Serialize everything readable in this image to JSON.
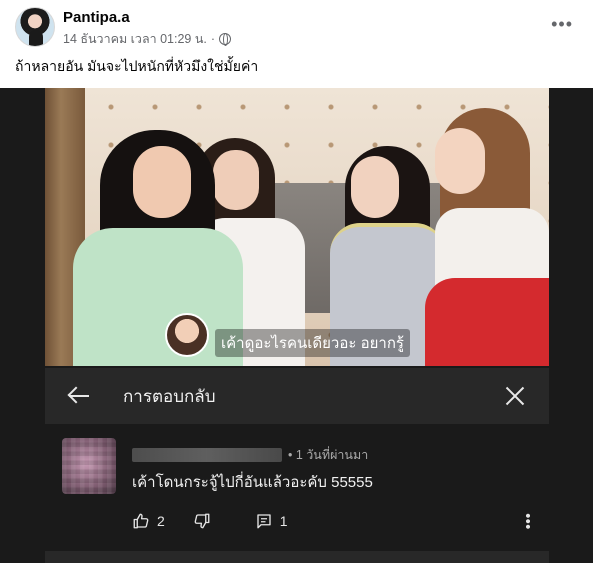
{
  "post": {
    "author": "Pantipa.a",
    "timestamp": "14 ธันวาคม เวลา 01:29 น.",
    "separator": "·",
    "privacy_icon": "globe-icon",
    "more_label": "•••",
    "caption": "ถ้าหลายอัน มันจะไปหนักที่หัวมึงใช่มั้ยค่า"
  },
  "video": {
    "subtitle": "เค้าดูอะไรคนเดียวอะ อยากรู้"
  },
  "reply_panel": {
    "title": "การตอบกลับ",
    "back_icon": "back-arrow-icon",
    "close_icon": "close-icon"
  },
  "comment": {
    "time": "• 1 วันที่ผ่านมา",
    "text": "เค้าโดนกระจู้ไปกี่อันแล้วอะคับ 55555",
    "likes": "2",
    "replies": "1"
  },
  "colors": {
    "panel_bg": "#282828",
    "shot_bg": "#1a1a1a",
    "meta_gray": "#65676b"
  }
}
